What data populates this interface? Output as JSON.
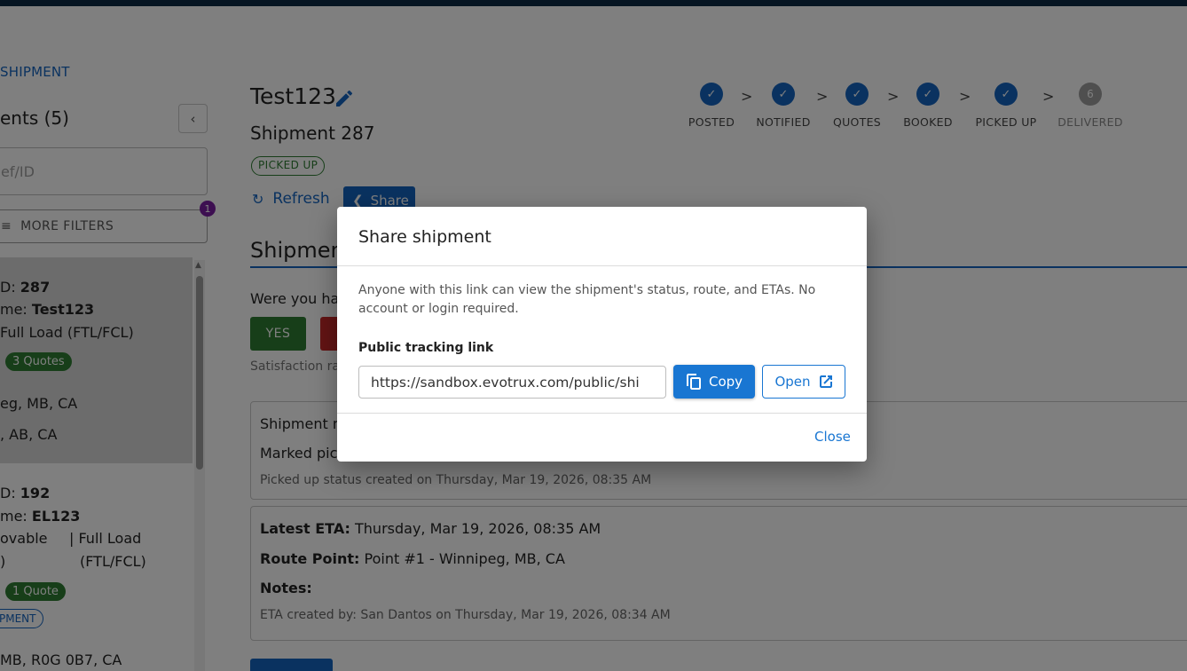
{
  "sidebar": {
    "link": "SHIPMENT",
    "title": "ents (5)",
    "collapse_icon": "chevron-left-icon",
    "search_placeholder": "ef/ID",
    "filters_label": "MORE FILTERS",
    "filters_badge": "1",
    "cards": [
      {
        "id_label": "D: ",
        "id_value": "287",
        "name_label": "me: ",
        "name_value": "Test123",
        "type": "Full Load (FTL/FCL)",
        "quotes": "3 Quotes",
        "origin": "eg, MB, CA",
        "destination": ", AB, CA"
      },
      {
        "id_label": "D: ",
        "id_value": "192",
        "name_label": "me: ",
        "name_value": "EL123",
        "mode_a": "ovable",
        "mode_a2": ")",
        "type_a": "| Full Load",
        "type_b": "(FTL/FCL)",
        "quotes": "1 Quote",
        "tag": "PMENT",
        "origin": "MB, R0G 0B7, CA"
      }
    ]
  },
  "header": {
    "title": "Test123",
    "subtitle": "Shipment 287",
    "status": "PICKED UP",
    "refresh_label": "Refresh",
    "share_label": "Share"
  },
  "stepper": {
    "steps": [
      {
        "label": "POSTED",
        "done": true,
        "num": ""
      },
      {
        "label": "NOTIFIED",
        "done": true,
        "num": ""
      },
      {
        "label": "QUOTES",
        "done": true,
        "num": ""
      },
      {
        "label": "BOOKED",
        "done": true,
        "num": ""
      },
      {
        "label": "PICKED UP",
        "done": true,
        "num": ""
      },
      {
        "label": "DELIVERED",
        "done": false,
        "num": "6"
      }
    ],
    "separator": ">"
  },
  "main": {
    "section_title": "Shipmen",
    "question": "Were you ha",
    "yes_label": "YES",
    "satisfaction": "Satisfaction ra",
    "status_panel": {
      "title": "Shipment m",
      "body": "Marked pic",
      "meta": "Picked up status created on Thursday, Mar 19, 2026, 08:35 AM"
    },
    "eta_panel": {
      "eta_label": "Latest ETA:",
      "eta_value": " Thursday, Mar 19, 2026, 08:35 AM",
      "route_label": "Route Point:",
      "route_value": " Point #1 - Winnipeg, MB, CA",
      "notes_label": "Notes:",
      "meta": "ETA created by: San Dantos on Thursday, Mar 19, 2026, 08:34 AM"
    }
  },
  "dialog": {
    "title": "Share shipment",
    "description": "Anyone with this link can view the shipment's status, route, and ETAs. No account or login required.",
    "link_label": "Public tracking link",
    "link_value": "https://sandbox.evotrux.com/public/shi",
    "copy_label": "Copy",
    "open_label": "Open",
    "close_label": "Close"
  },
  "colors": {
    "primary": "#1976d2",
    "success": "#2e7d32",
    "danger": "#c62828",
    "badge": "#7b1fa2",
    "topbar": "#0d2b45"
  }
}
